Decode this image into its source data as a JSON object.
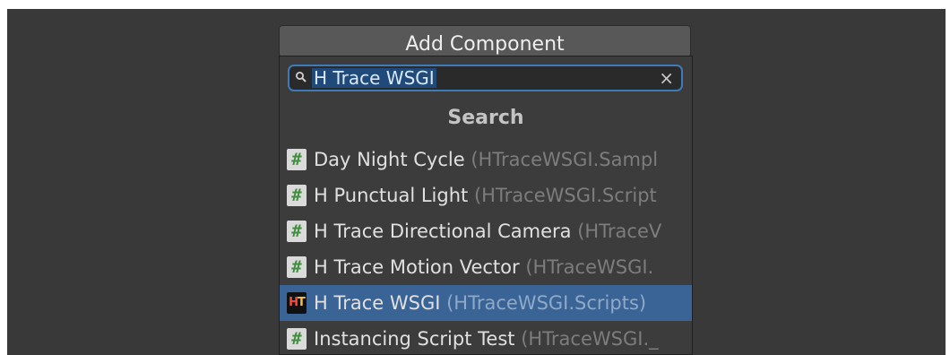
{
  "add_component": {
    "label": "Add Component"
  },
  "search": {
    "query": "H Trace WSGI",
    "clear_symbol": "×"
  },
  "section": {
    "title": "Search"
  },
  "items": [
    {
      "name": "Day Night Cycle",
      "namespace": "(HTraceWSGI.Sampl",
      "icon": "script-icon",
      "selected": false
    },
    {
      "name": "H Punctual Light",
      "namespace": "(HTraceWSGI.Script",
      "icon": "script-icon",
      "selected": false
    },
    {
      "name": "H Trace Directional Camera",
      "namespace": "(HTraceV",
      "icon": "script-icon",
      "selected": false
    },
    {
      "name": "H Trace Motion Vector",
      "namespace": "(HTraceWSGI.",
      "icon": "script-icon",
      "selected": false
    },
    {
      "name": "H Trace WSGI",
      "namespace": "(HTraceWSGI.Scripts)",
      "icon": "htrace-logo-icon",
      "selected": true
    },
    {
      "name": "Instancing Script Test",
      "namespace": "(HTraceWSGI._",
      "icon": "script-icon",
      "selected": false
    }
  ],
  "colors": {
    "editor_bg": "#393939",
    "popup_bg": "#3c3c3c",
    "selection": "#3a6496",
    "search_focus": "#3e7bb8",
    "namespace_text": "#7d7d7d"
  }
}
